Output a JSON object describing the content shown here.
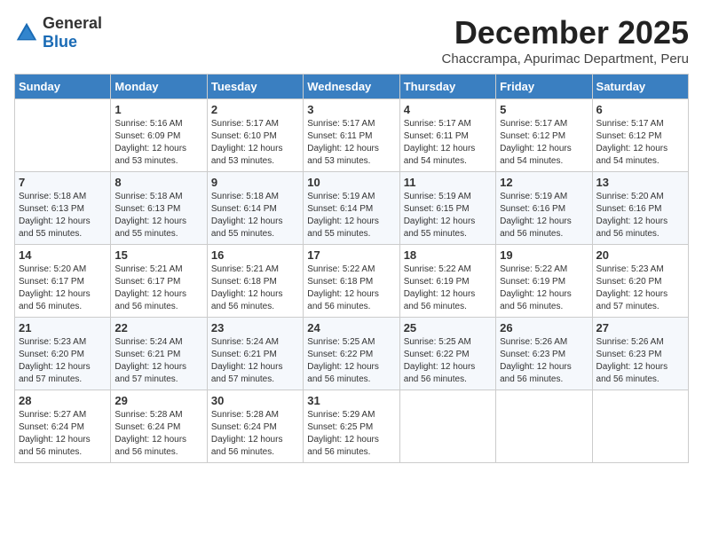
{
  "logo": {
    "general": "General",
    "blue": "Blue"
  },
  "title": "December 2025",
  "subtitle": "Chaccrampa, Apurimac Department, Peru",
  "days_of_week": [
    "Sunday",
    "Monday",
    "Tuesday",
    "Wednesday",
    "Thursday",
    "Friday",
    "Saturday"
  ],
  "weeks": [
    [
      {
        "day": "",
        "info": ""
      },
      {
        "day": "1",
        "info": "Sunrise: 5:16 AM\nSunset: 6:09 PM\nDaylight: 12 hours\nand 53 minutes."
      },
      {
        "day": "2",
        "info": "Sunrise: 5:17 AM\nSunset: 6:10 PM\nDaylight: 12 hours\nand 53 minutes."
      },
      {
        "day": "3",
        "info": "Sunrise: 5:17 AM\nSunset: 6:11 PM\nDaylight: 12 hours\nand 53 minutes."
      },
      {
        "day": "4",
        "info": "Sunrise: 5:17 AM\nSunset: 6:11 PM\nDaylight: 12 hours\nand 54 minutes."
      },
      {
        "day": "5",
        "info": "Sunrise: 5:17 AM\nSunset: 6:12 PM\nDaylight: 12 hours\nand 54 minutes."
      },
      {
        "day": "6",
        "info": "Sunrise: 5:17 AM\nSunset: 6:12 PM\nDaylight: 12 hours\nand 54 minutes."
      }
    ],
    [
      {
        "day": "7",
        "info": "Sunrise: 5:18 AM\nSunset: 6:13 PM\nDaylight: 12 hours\nand 55 minutes."
      },
      {
        "day": "8",
        "info": "Sunrise: 5:18 AM\nSunset: 6:13 PM\nDaylight: 12 hours\nand 55 minutes."
      },
      {
        "day": "9",
        "info": "Sunrise: 5:18 AM\nSunset: 6:14 PM\nDaylight: 12 hours\nand 55 minutes."
      },
      {
        "day": "10",
        "info": "Sunrise: 5:19 AM\nSunset: 6:14 PM\nDaylight: 12 hours\nand 55 minutes."
      },
      {
        "day": "11",
        "info": "Sunrise: 5:19 AM\nSunset: 6:15 PM\nDaylight: 12 hours\nand 55 minutes."
      },
      {
        "day": "12",
        "info": "Sunrise: 5:19 AM\nSunset: 6:16 PM\nDaylight: 12 hours\nand 56 minutes."
      },
      {
        "day": "13",
        "info": "Sunrise: 5:20 AM\nSunset: 6:16 PM\nDaylight: 12 hours\nand 56 minutes."
      }
    ],
    [
      {
        "day": "14",
        "info": "Sunrise: 5:20 AM\nSunset: 6:17 PM\nDaylight: 12 hours\nand 56 minutes."
      },
      {
        "day": "15",
        "info": "Sunrise: 5:21 AM\nSunset: 6:17 PM\nDaylight: 12 hours\nand 56 minutes."
      },
      {
        "day": "16",
        "info": "Sunrise: 5:21 AM\nSunset: 6:18 PM\nDaylight: 12 hours\nand 56 minutes."
      },
      {
        "day": "17",
        "info": "Sunrise: 5:22 AM\nSunset: 6:18 PM\nDaylight: 12 hours\nand 56 minutes."
      },
      {
        "day": "18",
        "info": "Sunrise: 5:22 AM\nSunset: 6:19 PM\nDaylight: 12 hours\nand 56 minutes."
      },
      {
        "day": "19",
        "info": "Sunrise: 5:22 AM\nSunset: 6:19 PM\nDaylight: 12 hours\nand 56 minutes."
      },
      {
        "day": "20",
        "info": "Sunrise: 5:23 AM\nSunset: 6:20 PM\nDaylight: 12 hours\nand 57 minutes."
      }
    ],
    [
      {
        "day": "21",
        "info": "Sunrise: 5:23 AM\nSunset: 6:20 PM\nDaylight: 12 hours\nand 57 minutes."
      },
      {
        "day": "22",
        "info": "Sunrise: 5:24 AM\nSunset: 6:21 PM\nDaylight: 12 hours\nand 57 minutes."
      },
      {
        "day": "23",
        "info": "Sunrise: 5:24 AM\nSunset: 6:21 PM\nDaylight: 12 hours\nand 57 minutes."
      },
      {
        "day": "24",
        "info": "Sunrise: 5:25 AM\nSunset: 6:22 PM\nDaylight: 12 hours\nand 56 minutes."
      },
      {
        "day": "25",
        "info": "Sunrise: 5:25 AM\nSunset: 6:22 PM\nDaylight: 12 hours\nand 56 minutes."
      },
      {
        "day": "26",
        "info": "Sunrise: 5:26 AM\nSunset: 6:23 PM\nDaylight: 12 hours\nand 56 minutes."
      },
      {
        "day": "27",
        "info": "Sunrise: 5:26 AM\nSunset: 6:23 PM\nDaylight: 12 hours\nand 56 minutes."
      }
    ],
    [
      {
        "day": "28",
        "info": "Sunrise: 5:27 AM\nSunset: 6:24 PM\nDaylight: 12 hours\nand 56 minutes."
      },
      {
        "day": "29",
        "info": "Sunrise: 5:28 AM\nSunset: 6:24 PM\nDaylight: 12 hours\nand 56 minutes."
      },
      {
        "day": "30",
        "info": "Sunrise: 5:28 AM\nSunset: 6:24 PM\nDaylight: 12 hours\nand 56 minutes."
      },
      {
        "day": "31",
        "info": "Sunrise: 5:29 AM\nSunset: 6:25 PM\nDaylight: 12 hours\nand 56 minutes."
      },
      {
        "day": "",
        "info": ""
      },
      {
        "day": "",
        "info": ""
      },
      {
        "day": "",
        "info": ""
      }
    ]
  ]
}
